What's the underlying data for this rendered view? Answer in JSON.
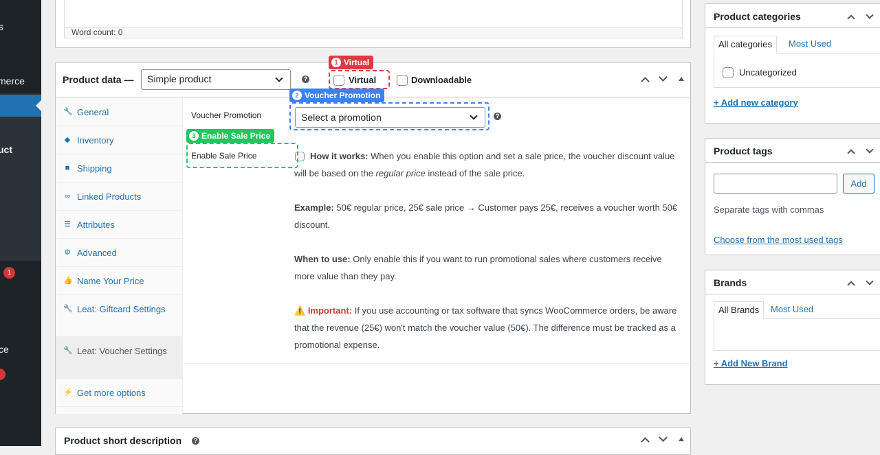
{
  "admin_menu": {
    "items": [
      "s",
      "merce",
      "uct",
      "ce"
    ],
    "badge": "1"
  },
  "editor": {
    "word_count": "Word count: 0"
  },
  "product_data": {
    "title": "Product data —",
    "type_value": "Simple product",
    "virtual_label": "Virtual",
    "downloadable_label": "Downloadable",
    "tabs": [
      {
        "label": "General",
        "icon": "wrench-icon"
      },
      {
        "label": "Inventory",
        "icon": "tag-icon"
      },
      {
        "label": "Shipping",
        "icon": "truck-icon"
      },
      {
        "label": "Linked Products",
        "icon": "link-icon"
      },
      {
        "label": "Attributes",
        "icon": "list-icon"
      },
      {
        "label": "Advanced",
        "icon": "gear-icon"
      },
      {
        "label": "Name Your Price",
        "icon": "thumbs-up-icon"
      },
      {
        "label": "Leat: Giftcard Settings",
        "icon": "wrench-icon"
      },
      {
        "label": "Leat: Voucher Settings",
        "icon": "wrench-icon"
      },
      {
        "label": "Get more options",
        "icon": "plugin-icon"
      }
    ],
    "voucher_promotion_label": "Voucher Promotion",
    "promotion_select": "Select a promotion",
    "enable_sale_label": "Enable Sale Price",
    "how_title": "How it works:",
    "how_text_1": " When you enable this option and set a sale price, the voucher discount value will be based on the ",
    "how_em": "regular price",
    "how_text_2": " instead of the sale price.",
    "example_title": "Example:",
    "example_text": " 50€ regular price, 25€ sale price → Customer pays 25€, receives a voucher worth 50€ discount.",
    "when_title": "When to use:",
    "when_text": " Only enable this if you want to run promotional sales where customers receive more value than they pay.",
    "important_icon": "⚠️",
    "important_title": "Important:",
    "important_text": " If you use accounting or tax software that syncs WooCommerce orders, be aware that the revenue (25€) won't match the voucher value (50€). The difference must be tracked as a promotional expense."
  },
  "callouts": [
    {
      "num": "1",
      "label": "Virtual",
      "color": "#e0393e"
    },
    {
      "num": "2",
      "label": "Voucher Promotion",
      "color": "#3b82f6"
    },
    {
      "num": "3",
      "label": "Enable Sale Price",
      "color": "#22c55e"
    }
  ],
  "short_description": {
    "title": "Product short description"
  },
  "categories": {
    "title": "Product categories",
    "tab_all": "All categories",
    "tab_most": "Most Used",
    "item": "Uncategorized",
    "add_link": "+ Add new category"
  },
  "tags": {
    "title": "Product tags",
    "add_button": "Add",
    "hint": "Separate tags with commas",
    "choose_link": "Choose from the most used tags"
  },
  "brands": {
    "title": "Brands",
    "tab_all": "All Brands",
    "tab_most": "Most Used",
    "add_link": "+ Add New Brand"
  }
}
